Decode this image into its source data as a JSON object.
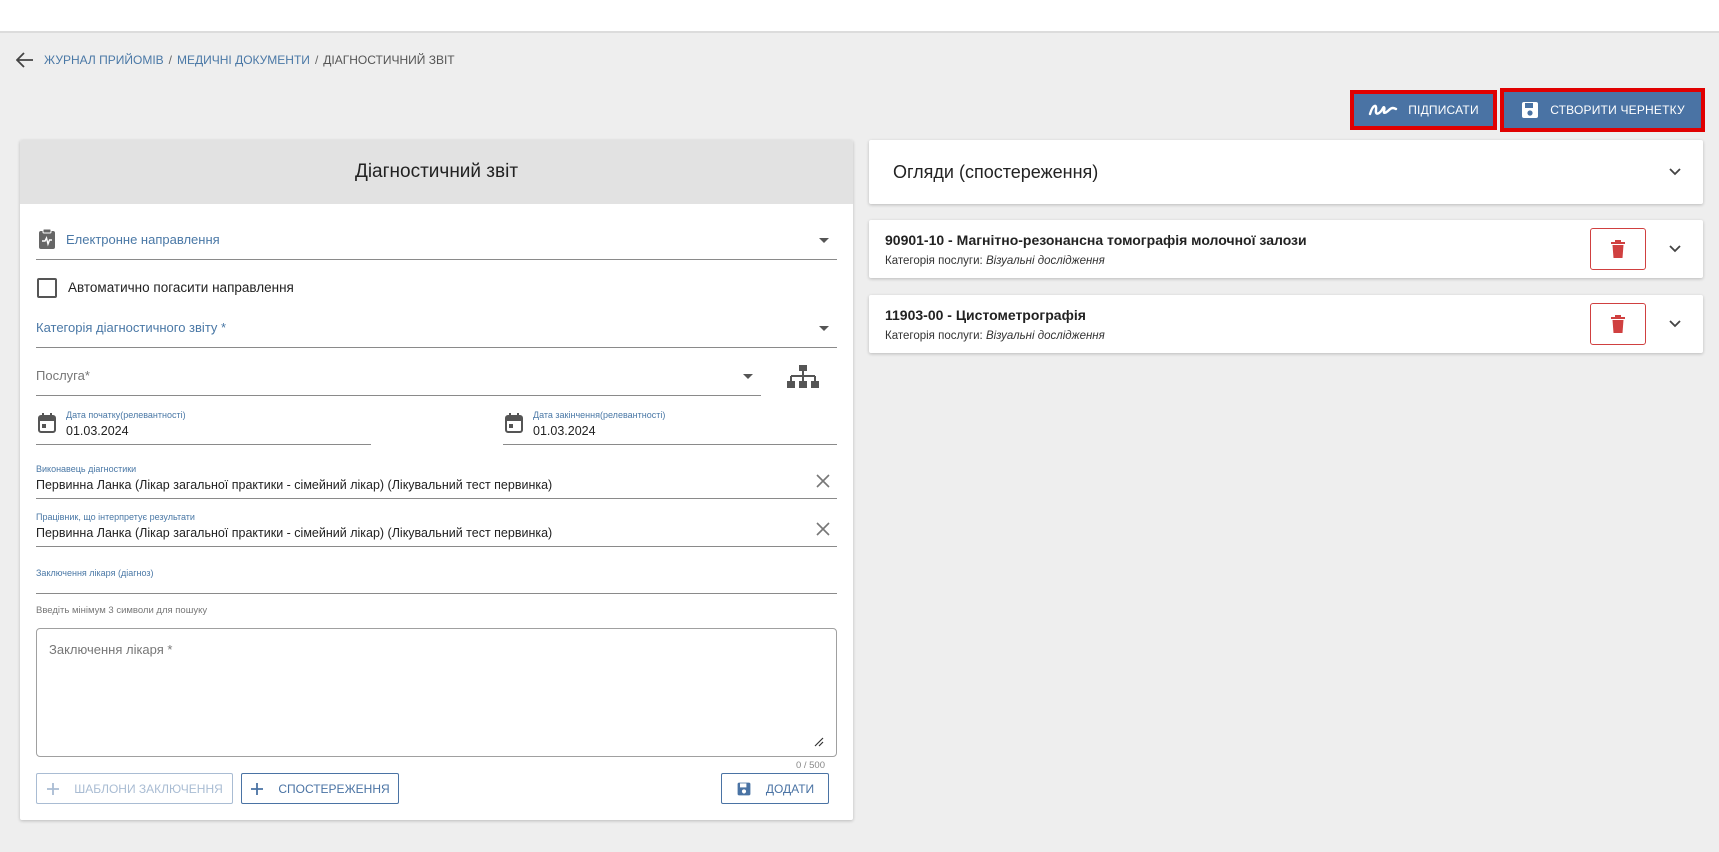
{
  "breadcrumb": {
    "items": [
      "ЖУРНАЛ ПРИЙОМІВ",
      "МЕДИЧНІ ДОКУМЕНТИ"
    ],
    "separator": "/",
    "current": "ДІАГНОСТИЧНИЙ ЗВІТ"
  },
  "actions": {
    "sign_label": "ПІДПИСАТИ",
    "draft_label": "СТВОРИТИ ЧЕРНЕТКУ"
  },
  "form": {
    "title": "Діагностичний звіт",
    "referral_label": "Електронне направлення",
    "auto_close_label": "Автоматично погасити направлення",
    "auto_close_checked": false,
    "category_label": "Категорія діагностичного звіту *",
    "service_placeholder": "Послуга*",
    "start_date_label": "Дата початку(релевантності)",
    "start_date": "01.03.2024",
    "end_date_label": "Дата закінчення(релевантності)",
    "end_date": "01.03.2024",
    "performer_label": "Виконавець діагностики",
    "performer_value": "Первинна Ланка  (Лікар загальної практики - сімейний лікар) (Лікувальний тест первинка)",
    "interpreter_label": "Працівник, що інтерпретує результати",
    "interpreter_value": "Первинна Ланка  (Лікар загальної практики - сімейний лікар) (Лікувальний тест первинка)",
    "diagnosis_label": "Заключення лікаря (діагноз)",
    "diagnosis_hint": "Введіть мінімум 3 символи для пошуку",
    "conclusion_placeholder": "Заключення лікаря *",
    "char_counter": "0 / 500",
    "templates_button": "ШАБЛОНИ ЗАКЛЮЧЕННЯ",
    "observations_button": "СПОСТЕРЕЖЕННЯ",
    "add_button": "ДОДАТИ"
  },
  "observations": {
    "panel_title": "Огляди (спостереження)",
    "category_prefix": "Категорія послуги:",
    "items": [
      {
        "title": "90901-10 - Магнітно-резонансна томографія молочної залози",
        "category": "Візуальні дослідження"
      },
      {
        "title": "11903-00 - Цистометрографія",
        "category": "Візуальні дослідження"
      }
    ]
  },
  "colors": {
    "primary": "#4a73a4",
    "link": "#4a78a6",
    "highlight_border": "#e00000",
    "delete": "#d04040"
  },
  "icons": [
    "arrow-left-icon",
    "signature-icon",
    "save-icon",
    "clipboard-pulse-icon",
    "hierarchy-icon",
    "calendar-icon",
    "close-icon",
    "plus-icon",
    "trash-icon",
    "chevron-down-icon",
    "resize-handle-icon"
  ]
}
